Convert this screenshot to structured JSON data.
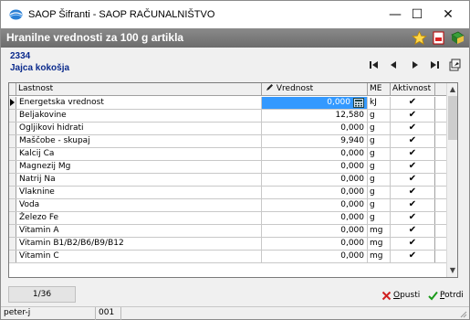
{
  "window": {
    "title": "SAOP Šifranti - SAOP RAČUNALNIŠTVO",
    "minimize": "—",
    "maximize": "☐",
    "close": "✕"
  },
  "caption": {
    "title": "Hranilne vrednosti za 100 g artikla"
  },
  "article": {
    "code": "2334",
    "name": "Jajca kokošja"
  },
  "grid": {
    "columns": {
      "property": "Lastnost",
      "value": "Vrednost",
      "unit": "ME",
      "active": "Aktivnost"
    },
    "rows": [
      {
        "property": "Energetska vrednost",
        "value": "0,000",
        "unit": "kJ",
        "active": true
      },
      {
        "property": "Beljakovine",
        "value": "12,580",
        "unit": "g",
        "active": true
      },
      {
        "property": "Ogljikovi hidrati",
        "value": "0,000",
        "unit": "g",
        "active": true
      },
      {
        "property": "Maščobe - skupaj",
        "value": "9,940",
        "unit": "g",
        "active": true
      },
      {
        "property": "Kalcij Ca",
        "value": "0,000",
        "unit": "g",
        "active": true
      },
      {
        "property": "Magnezij Mg",
        "value": "0,000",
        "unit": "g",
        "active": true
      },
      {
        "property": "Natrij Na",
        "value": "0,000",
        "unit": "g",
        "active": true
      },
      {
        "property": "Vlaknine",
        "value": "0,000",
        "unit": "g",
        "active": true
      },
      {
        "property": "Voda",
        "value": "0,000",
        "unit": "g",
        "active": true
      },
      {
        "property": "Železo Fe",
        "value": "0,000",
        "unit": "g",
        "active": true
      },
      {
        "property": "Vitamin A",
        "value": "0,000",
        "unit": "mg",
        "active": true
      },
      {
        "property": "Vitamin B1/B2/B6/B9/B12",
        "value": "0,000",
        "unit": "mg",
        "active": true
      },
      {
        "property": "Vitamin C",
        "value": "0,000",
        "unit": "mg",
        "active": true
      }
    ]
  },
  "footer": {
    "counter": "1/36",
    "cancel_label": "Opusti",
    "confirm_label": "Potrdi"
  },
  "status": {
    "user": "peter-j",
    "company": "001"
  },
  "colors": {
    "accent": "#3399ff",
    "header_text": "#0a2a8c",
    "caption_bg": "#7a7a7a"
  }
}
